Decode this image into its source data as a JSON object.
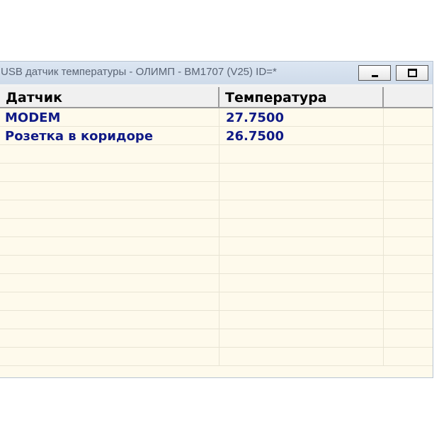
{
  "window": {
    "title": "USB датчик температуры - ОЛИМП - ВМ1707 (V25) ID=*",
    "minimize_icon": "minimize-icon",
    "maximize_icon": "maximize-icon"
  },
  "table": {
    "columns": [
      "Датчик",
      "Температура",
      ""
    ],
    "rows": [
      {
        "sensor": "MODEM",
        "temperature": "27.7500"
      },
      {
        "sensor": "Розетка в коридоре",
        "temperature": "26.7500"
      },
      {
        "sensor": "",
        "temperature": ""
      },
      {
        "sensor": "",
        "temperature": ""
      },
      {
        "sensor": "",
        "temperature": ""
      },
      {
        "sensor": "",
        "temperature": ""
      },
      {
        "sensor": "",
        "temperature": ""
      },
      {
        "sensor": "",
        "temperature": ""
      },
      {
        "sensor": "",
        "temperature": ""
      },
      {
        "sensor": "",
        "temperature": ""
      },
      {
        "sensor": "",
        "temperature": ""
      },
      {
        "sensor": "",
        "temperature": ""
      },
      {
        "sensor": "",
        "temperature": ""
      },
      {
        "sensor": "",
        "temperature": ""
      }
    ]
  },
  "colors": {
    "row_background": "#fefaec",
    "value_text": "#101a86",
    "titlebar": "#dce6f2"
  }
}
